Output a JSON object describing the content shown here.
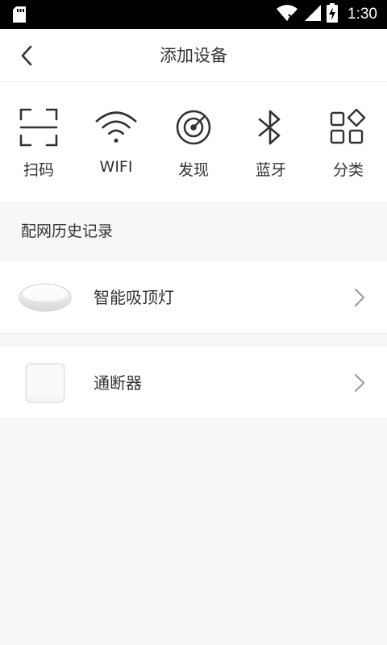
{
  "status_bar": {
    "time": "1:30"
  },
  "header": {
    "title": "添加设备"
  },
  "modes": [
    {
      "label": "扫码",
      "icon": "scan-icon"
    },
    {
      "label": "WIFI",
      "icon": "wifi-icon"
    },
    {
      "label": "发现",
      "icon": "radar-icon"
    },
    {
      "label": "蓝牙",
      "icon": "bluetooth-icon"
    },
    {
      "label": "分类",
      "icon": "category-icon"
    }
  ],
  "history": {
    "title": "配网历史记录",
    "devices": [
      {
        "name": "智能吸顶灯"
      },
      {
        "name": "通断器"
      }
    ]
  },
  "colors": {
    "icon_stroke": "#333333",
    "background": "#f7f7f7",
    "card": "#ffffff"
  }
}
